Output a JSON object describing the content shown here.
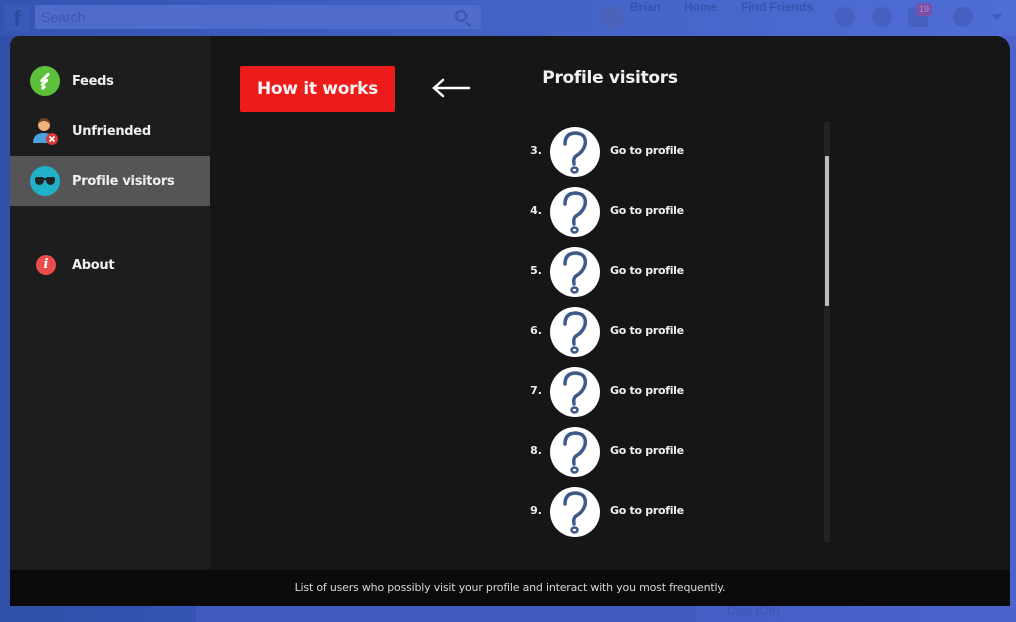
{
  "background": {
    "search_placeholder": "Search",
    "user_name": "Brian",
    "nav_home": "Home",
    "nav_find_friends": "Find Friends",
    "notification_count": "19",
    "chat_status": "Chat (Off)"
  },
  "sidebar": {
    "items": [
      {
        "label": "Feeds",
        "icon": "feeds-icon"
      },
      {
        "label": "Unfriended",
        "icon": "unfriended-icon"
      },
      {
        "label": "Profile visitors",
        "icon": "sunglasses-icon",
        "active": true
      },
      {
        "label": "About",
        "icon": "info-icon"
      }
    ]
  },
  "main": {
    "how_it_works_label": "How it works",
    "title": "Profile visitors",
    "visitors": [
      {
        "rank": "3.",
        "link": "Go to profile"
      },
      {
        "rank": "4.",
        "link": "Go to profile"
      },
      {
        "rank": "5.",
        "link": "Go to profile"
      },
      {
        "rank": "6.",
        "link": "Go to profile"
      },
      {
        "rank": "7.",
        "link": "Go to profile"
      },
      {
        "rank": "8.",
        "link": "Go to profile"
      },
      {
        "rank": "9.",
        "link": "Go to profile"
      }
    ]
  },
  "footer": {
    "text": "List of users who possibly visit your profile and interact with you most frequently."
  },
  "colors": {
    "accent_red": "#ee1b1b",
    "active_item": "#555555",
    "modal_bg": "#161616"
  }
}
